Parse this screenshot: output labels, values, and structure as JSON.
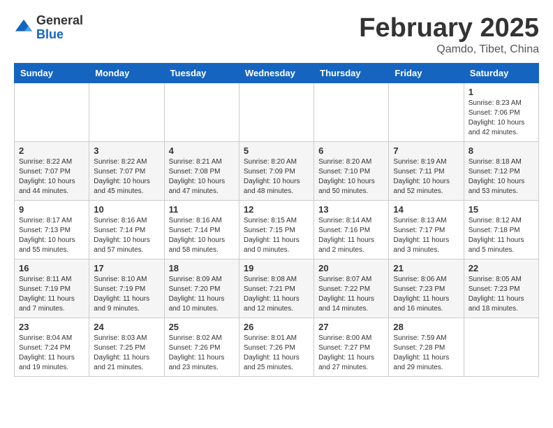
{
  "header": {
    "logo_general": "General",
    "logo_blue": "Blue",
    "month_title": "February 2025",
    "location": "Qamdo, Tibet, China"
  },
  "days_of_week": [
    "Sunday",
    "Monday",
    "Tuesday",
    "Wednesday",
    "Thursday",
    "Friday",
    "Saturday"
  ],
  "weeks": [
    [
      {
        "day": "",
        "detail": ""
      },
      {
        "day": "",
        "detail": ""
      },
      {
        "day": "",
        "detail": ""
      },
      {
        "day": "",
        "detail": ""
      },
      {
        "day": "",
        "detail": ""
      },
      {
        "day": "",
        "detail": ""
      },
      {
        "day": "1",
        "detail": "Sunrise: 8:23 AM\nSunset: 7:06 PM\nDaylight: 10 hours\nand 42 minutes."
      }
    ],
    [
      {
        "day": "2",
        "detail": "Sunrise: 8:22 AM\nSunset: 7:07 PM\nDaylight: 10 hours\nand 44 minutes."
      },
      {
        "day": "3",
        "detail": "Sunrise: 8:22 AM\nSunset: 7:07 PM\nDaylight: 10 hours\nand 45 minutes."
      },
      {
        "day": "4",
        "detail": "Sunrise: 8:21 AM\nSunset: 7:08 PM\nDaylight: 10 hours\nand 47 minutes."
      },
      {
        "day": "5",
        "detail": "Sunrise: 8:20 AM\nSunset: 7:09 PM\nDaylight: 10 hours\nand 48 minutes."
      },
      {
        "day": "6",
        "detail": "Sunrise: 8:20 AM\nSunset: 7:10 PM\nDaylight: 10 hours\nand 50 minutes."
      },
      {
        "day": "7",
        "detail": "Sunrise: 8:19 AM\nSunset: 7:11 PM\nDaylight: 10 hours\nand 52 minutes."
      },
      {
        "day": "8",
        "detail": "Sunrise: 8:18 AM\nSunset: 7:12 PM\nDaylight: 10 hours\nand 53 minutes."
      }
    ],
    [
      {
        "day": "9",
        "detail": "Sunrise: 8:17 AM\nSunset: 7:13 PM\nDaylight: 10 hours\nand 55 minutes."
      },
      {
        "day": "10",
        "detail": "Sunrise: 8:16 AM\nSunset: 7:14 PM\nDaylight: 10 hours\nand 57 minutes."
      },
      {
        "day": "11",
        "detail": "Sunrise: 8:16 AM\nSunset: 7:14 PM\nDaylight: 10 hours\nand 58 minutes."
      },
      {
        "day": "12",
        "detail": "Sunrise: 8:15 AM\nSunset: 7:15 PM\nDaylight: 11 hours\nand 0 minutes."
      },
      {
        "day": "13",
        "detail": "Sunrise: 8:14 AM\nSunset: 7:16 PM\nDaylight: 11 hours\nand 2 minutes."
      },
      {
        "day": "14",
        "detail": "Sunrise: 8:13 AM\nSunset: 7:17 PM\nDaylight: 11 hours\nand 3 minutes."
      },
      {
        "day": "15",
        "detail": "Sunrise: 8:12 AM\nSunset: 7:18 PM\nDaylight: 11 hours\nand 5 minutes."
      }
    ],
    [
      {
        "day": "16",
        "detail": "Sunrise: 8:11 AM\nSunset: 7:19 PM\nDaylight: 11 hours\nand 7 minutes."
      },
      {
        "day": "17",
        "detail": "Sunrise: 8:10 AM\nSunset: 7:19 PM\nDaylight: 11 hours\nand 9 minutes."
      },
      {
        "day": "18",
        "detail": "Sunrise: 8:09 AM\nSunset: 7:20 PM\nDaylight: 11 hours\nand 10 minutes."
      },
      {
        "day": "19",
        "detail": "Sunrise: 8:08 AM\nSunset: 7:21 PM\nDaylight: 11 hours\nand 12 minutes."
      },
      {
        "day": "20",
        "detail": "Sunrise: 8:07 AM\nSunset: 7:22 PM\nDaylight: 11 hours\nand 14 minutes."
      },
      {
        "day": "21",
        "detail": "Sunrise: 8:06 AM\nSunset: 7:23 PM\nDaylight: 11 hours\nand 16 minutes."
      },
      {
        "day": "22",
        "detail": "Sunrise: 8:05 AM\nSunset: 7:23 PM\nDaylight: 11 hours\nand 18 minutes."
      }
    ],
    [
      {
        "day": "23",
        "detail": "Sunrise: 8:04 AM\nSunset: 7:24 PM\nDaylight: 11 hours\nand 19 minutes."
      },
      {
        "day": "24",
        "detail": "Sunrise: 8:03 AM\nSunset: 7:25 PM\nDaylight: 11 hours\nand 21 minutes."
      },
      {
        "day": "25",
        "detail": "Sunrise: 8:02 AM\nSunset: 7:26 PM\nDaylight: 11 hours\nand 23 minutes."
      },
      {
        "day": "26",
        "detail": "Sunrise: 8:01 AM\nSunset: 7:26 PM\nDaylight: 11 hours\nand 25 minutes."
      },
      {
        "day": "27",
        "detail": "Sunrise: 8:00 AM\nSunset: 7:27 PM\nDaylight: 11 hours\nand 27 minutes."
      },
      {
        "day": "28",
        "detail": "Sunrise: 7:59 AM\nSunset: 7:28 PM\nDaylight: 11 hours\nand 29 minutes."
      },
      {
        "day": "",
        "detail": ""
      }
    ]
  ]
}
